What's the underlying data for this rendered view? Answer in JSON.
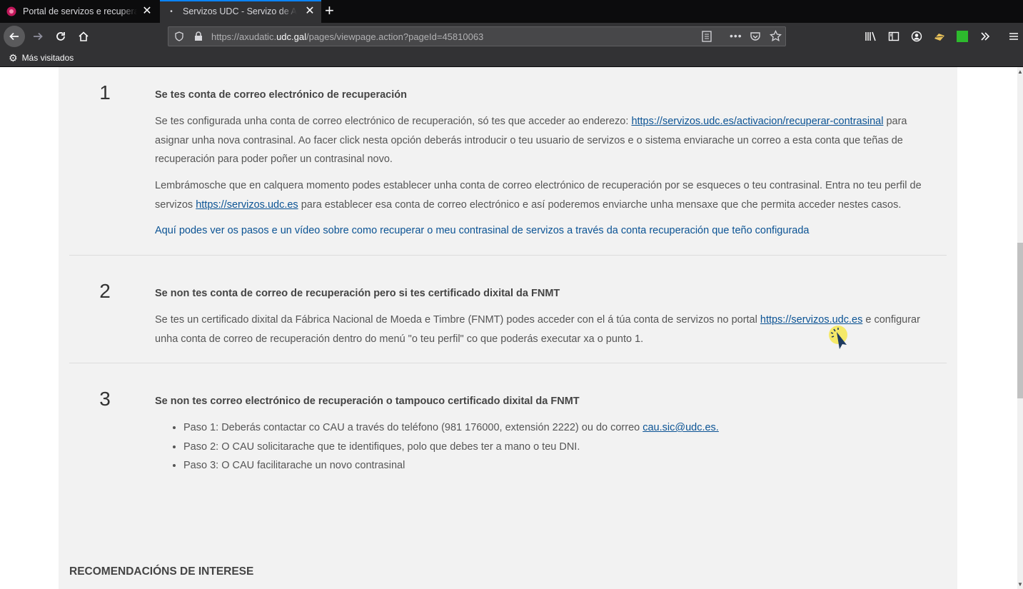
{
  "browser": {
    "tabs": [
      {
        "title": "Portal de servizos e recuperació",
        "active": false
      },
      {
        "title": "Servizos UDC - Servizo de Autent",
        "active": true
      }
    ],
    "url": {
      "prefix": "https://axudatic.",
      "host": "udc.gal",
      "path": "/pages/viewpage.action?pageId=45810063"
    },
    "bookmarks": [
      {
        "label": "Más visitados"
      }
    ]
  },
  "content": {
    "step1": {
      "number": "1",
      "heading": "Se tes conta de correo electrónico de recuperación",
      "p1_before": "Se tes configurada unha conta de correo electrónico de recuperación, só tes que acceder ao enderezo: ",
      "p1_link": "https://servizos.udc.es/activacion/recuperar-contrasinal",
      "p1_after": " para asignar unha nova contrasinal. Ao facer click nesta opción deberás introducir o teu usuario de servizos e o sistema enviarache un correo a esta conta que teñas de recuperación para poder poñer un contrasinal novo.",
      "p2_before": "Lembrámosche que en calquera momento podes establecer unha conta de correo electrónico de recuperación por se esqueces o teu contrasinal. Entra no teu perfil de servizos ",
      "p2_link": "https://servizos.udc.es",
      "p2_after": " para establecer esa conta de correo electrónico e así poderemos enviarche unha mensaxe que che permita acceder nestes casos.",
      "video_link": "Aquí podes ver os pasos e un vídeo sobre como recuperar o meu contrasinal de servizos a través da conta recuperación que teño configurada"
    },
    "step2": {
      "number": "2",
      "heading": "Se non tes conta de correo de recuperación pero si tes certificado dixital da FNMT",
      "p_before": "Se tes un certificado dixital da Fábrica Nacional de Moeda e Timbre (FNMT) podes acceder con el á túa conta de servizos no portal  ",
      "p_link": "https://servizos.udc.es",
      "p_after": " e configurar unha conta de correo de recuperación dentro do menú \"o teu perfil\" co que poderás executar xa o punto 1."
    },
    "step3": {
      "number": "3",
      "heading": "Se non tes correo electrónico de recuperación o tampouco certificado dixital da FNMT",
      "item1_before": "Paso 1: Deberás contactar co CAU a través do teléfono (981 176000, extensión 2222) ou do correo ",
      "item1_link": "cau.sic@udc.es.",
      "item2": "Paso 2: O CAU solicitarache que te identifiques, polo que debes ter a mano o teu DNI.",
      "item3": "Paso 3: O CAU facilitarache un novo contrasinal"
    },
    "section_title": "RECOMENDACIÓNS DE INTERESE"
  }
}
